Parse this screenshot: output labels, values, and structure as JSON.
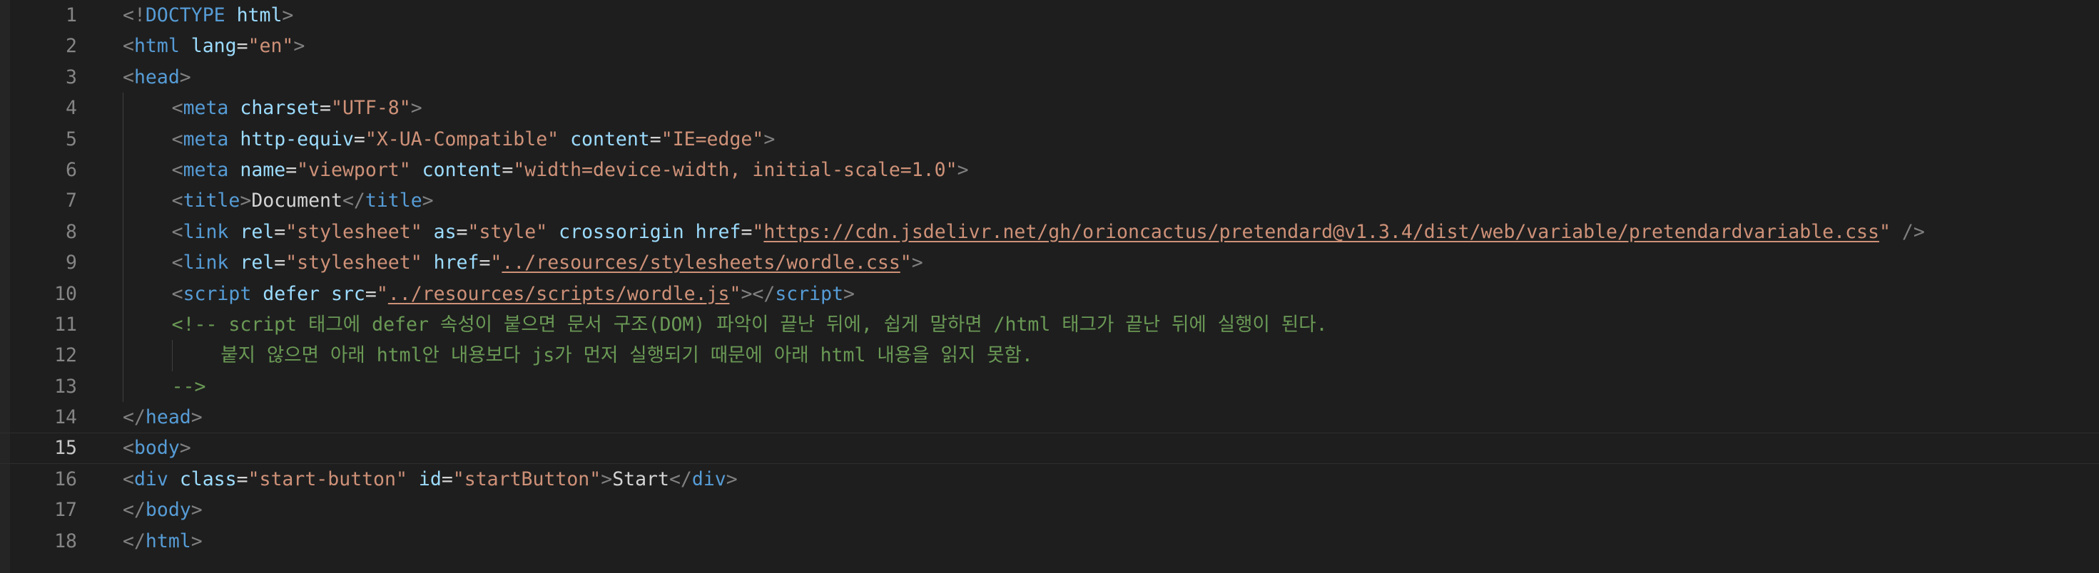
{
  "editor": {
    "current_line": 15,
    "colors": {
      "background": "#1e1e1e",
      "line_number": "#858585",
      "line_number_active": "#c6c6c6",
      "bracket": "#808080",
      "tag": "#569cd6",
      "attribute": "#9cdcfe",
      "string": "#ce9178",
      "text": "#d4d4d4",
      "comment": "#6a9955"
    },
    "lines": [
      {
        "number": "1",
        "indent": 0,
        "tokens": [
          {
            "t": "bracket",
            "v": "<!"
          },
          {
            "t": "tag",
            "v": "DOCTYPE"
          },
          {
            "t": "text",
            "v": " "
          },
          {
            "t": "attr",
            "v": "html"
          },
          {
            "t": "bracket",
            "v": ">"
          }
        ]
      },
      {
        "number": "2",
        "indent": 0,
        "tokens": [
          {
            "t": "bracket",
            "v": "<"
          },
          {
            "t": "tag",
            "v": "html"
          },
          {
            "t": "text",
            "v": " "
          },
          {
            "t": "attr",
            "v": "lang"
          },
          {
            "t": "eq",
            "v": "="
          },
          {
            "t": "str",
            "v": "\"en\""
          },
          {
            "t": "bracket",
            "v": ">"
          }
        ]
      },
      {
        "number": "3",
        "indent": 0,
        "tokens": [
          {
            "t": "bracket",
            "v": "<"
          },
          {
            "t": "tag",
            "v": "head"
          },
          {
            "t": "bracket",
            "v": ">"
          }
        ]
      },
      {
        "number": "4",
        "indent": 1,
        "tokens": [
          {
            "t": "bracket",
            "v": "<"
          },
          {
            "t": "tag",
            "v": "meta"
          },
          {
            "t": "text",
            "v": " "
          },
          {
            "t": "attr",
            "v": "charset"
          },
          {
            "t": "eq",
            "v": "="
          },
          {
            "t": "str",
            "v": "\"UTF-8\""
          },
          {
            "t": "bracket",
            "v": ">"
          }
        ]
      },
      {
        "number": "5",
        "indent": 1,
        "tokens": [
          {
            "t": "bracket",
            "v": "<"
          },
          {
            "t": "tag",
            "v": "meta"
          },
          {
            "t": "text",
            "v": " "
          },
          {
            "t": "attr",
            "v": "http-equiv"
          },
          {
            "t": "eq",
            "v": "="
          },
          {
            "t": "str",
            "v": "\"X-UA-Compatible\""
          },
          {
            "t": "text",
            "v": " "
          },
          {
            "t": "attr",
            "v": "content"
          },
          {
            "t": "eq",
            "v": "="
          },
          {
            "t": "str",
            "v": "\"IE=edge\""
          },
          {
            "t": "bracket",
            "v": ">"
          }
        ]
      },
      {
        "number": "6",
        "indent": 1,
        "tokens": [
          {
            "t": "bracket",
            "v": "<"
          },
          {
            "t": "tag",
            "v": "meta"
          },
          {
            "t": "text",
            "v": " "
          },
          {
            "t": "attr",
            "v": "name"
          },
          {
            "t": "eq",
            "v": "="
          },
          {
            "t": "str",
            "v": "\"viewport\""
          },
          {
            "t": "text",
            "v": " "
          },
          {
            "t": "attr",
            "v": "content"
          },
          {
            "t": "eq",
            "v": "="
          },
          {
            "t": "str",
            "v": "\"width=device-width, initial-scale=1.0\""
          },
          {
            "t": "bracket",
            "v": ">"
          }
        ]
      },
      {
        "number": "7",
        "indent": 1,
        "tokens": [
          {
            "t": "bracket",
            "v": "<"
          },
          {
            "t": "tag",
            "v": "title"
          },
          {
            "t": "bracket",
            "v": ">"
          },
          {
            "t": "text",
            "v": "Document"
          },
          {
            "t": "bracket",
            "v": "</"
          },
          {
            "t": "tag",
            "v": "title"
          },
          {
            "t": "bracket",
            "v": ">"
          }
        ]
      },
      {
        "number": "8",
        "indent": 1,
        "tokens": [
          {
            "t": "bracket",
            "v": "<"
          },
          {
            "t": "tag",
            "v": "link"
          },
          {
            "t": "text",
            "v": " "
          },
          {
            "t": "attr",
            "v": "rel"
          },
          {
            "t": "eq",
            "v": "="
          },
          {
            "t": "str",
            "v": "\"stylesheet\""
          },
          {
            "t": "text",
            "v": " "
          },
          {
            "t": "attr",
            "v": "as"
          },
          {
            "t": "eq",
            "v": "="
          },
          {
            "t": "str",
            "v": "\"style\""
          },
          {
            "t": "text",
            "v": " "
          },
          {
            "t": "attr",
            "v": "crossorigin"
          },
          {
            "t": "text",
            "v": " "
          },
          {
            "t": "attr",
            "v": "href"
          },
          {
            "t": "eq",
            "v": "="
          },
          {
            "t": "str",
            "v": "\""
          },
          {
            "t": "link",
            "v": "https://cdn.jsdelivr.net/gh/orioncactus/pretendard@v1.3.4/dist/web/variable/pretendardvariable.css"
          },
          {
            "t": "str",
            "v": "\""
          },
          {
            "t": "text",
            "v": " "
          },
          {
            "t": "bracket",
            "v": "/>"
          }
        ]
      },
      {
        "number": "9",
        "indent": 1,
        "tokens": [
          {
            "t": "bracket",
            "v": "<"
          },
          {
            "t": "tag",
            "v": "link"
          },
          {
            "t": "text",
            "v": " "
          },
          {
            "t": "attr",
            "v": "rel"
          },
          {
            "t": "eq",
            "v": "="
          },
          {
            "t": "str",
            "v": "\"stylesheet\""
          },
          {
            "t": "text",
            "v": " "
          },
          {
            "t": "attr",
            "v": "href"
          },
          {
            "t": "eq",
            "v": "="
          },
          {
            "t": "str",
            "v": "\""
          },
          {
            "t": "link",
            "v": "../resources/stylesheets/wordle.css"
          },
          {
            "t": "str",
            "v": "\""
          },
          {
            "t": "bracket",
            "v": ">"
          }
        ]
      },
      {
        "number": "10",
        "indent": 1,
        "tokens": [
          {
            "t": "bracket",
            "v": "<"
          },
          {
            "t": "tag",
            "v": "script"
          },
          {
            "t": "text",
            "v": " "
          },
          {
            "t": "attr",
            "v": "defer"
          },
          {
            "t": "text",
            "v": " "
          },
          {
            "t": "attr",
            "v": "src"
          },
          {
            "t": "eq",
            "v": "="
          },
          {
            "t": "str",
            "v": "\""
          },
          {
            "t": "link",
            "v": "../resources/scripts/wordle.js"
          },
          {
            "t": "str",
            "v": "\""
          },
          {
            "t": "bracket",
            "v": "></"
          },
          {
            "t": "tag",
            "v": "script"
          },
          {
            "t": "bracket",
            "v": ">"
          }
        ]
      },
      {
        "number": "11",
        "indent": 1,
        "tokens": [
          {
            "t": "comment",
            "v": "<!-- script 태그에 defer 속성이 붙으면 문서 구조(DOM) 파악이 끝난 뒤에, 쉽게 말하면 /html 태그가 끝난 뒤에 실행이 된다."
          }
        ]
      },
      {
        "number": "12",
        "indent": 2,
        "tokens": [
          {
            "t": "comment",
            "v": "붙지 않으면 아래 html안 내용보다 js가 먼저 실행되기 때문에 아래 html 내용을 읽지 못함."
          }
        ]
      },
      {
        "number": "13",
        "indent": 1,
        "tokens": [
          {
            "t": "comment",
            "v": "-->"
          }
        ]
      },
      {
        "number": "14",
        "indent": 0,
        "tokens": [
          {
            "t": "bracket",
            "v": "</"
          },
          {
            "t": "tag",
            "v": "head"
          },
          {
            "t": "bracket",
            "v": ">"
          }
        ]
      },
      {
        "number": "15",
        "indent": 0,
        "tokens": [
          {
            "t": "bracket",
            "v": "<"
          },
          {
            "t": "tag",
            "v": "body"
          },
          {
            "t": "bracket",
            "v": ">"
          }
        ]
      },
      {
        "number": "16",
        "indent": 0,
        "tokens": [
          {
            "t": "bracket",
            "v": "<"
          },
          {
            "t": "tag",
            "v": "div"
          },
          {
            "t": "text",
            "v": " "
          },
          {
            "t": "attr",
            "v": "class"
          },
          {
            "t": "eq",
            "v": "="
          },
          {
            "t": "str",
            "v": "\"start-button\""
          },
          {
            "t": "text",
            "v": " "
          },
          {
            "t": "attr",
            "v": "id"
          },
          {
            "t": "eq",
            "v": "="
          },
          {
            "t": "str",
            "v": "\"startButton\""
          },
          {
            "t": "bracket",
            "v": ">"
          },
          {
            "t": "text",
            "v": "Start"
          },
          {
            "t": "bracket",
            "v": "</"
          },
          {
            "t": "tag",
            "v": "div"
          },
          {
            "t": "bracket",
            "v": ">"
          }
        ]
      },
      {
        "number": "17",
        "indent": 0,
        "tokens": [
          {
            "t": "bracket",
            "v": "</"
          },
          {
            "t": "tag",
            "v": "body"
          },
          {
            "t": "bracket",
            "v": ">"
          }
        ]
      },
      {
        "number": "18",
        "indent": 0,
        "tokens": [
          {
            "t": "bracket",
            "v": "</"
          },
          {
            "t": "tag",
            "v": "html"
          },
          {
            "t": "bracket",
            "v": ">"
          }
        ]
      }
    ]
  }
}
